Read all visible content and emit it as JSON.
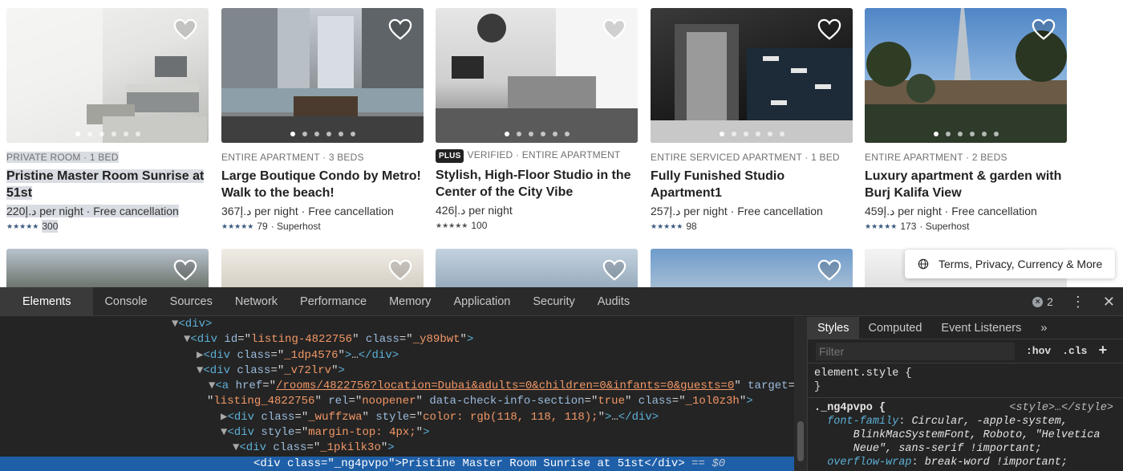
{
  "listings": [
    {
      "kicker": "PRIVATE ROOM · 1 BED",
      "title": "Pristine Master Room Sunrise at 51st",
      "price": "220د.إ per night · Free cancellation",
      "rating_count": "300",
      "rating_extra": "",
      "plus": "",
      "highlight": true,
      "colors": [
        "#e8e8e6",
        "#bcbcb8"
      ]
    },
    {
      "kicker": "ENTIRE APARTMENT · 3 BEDS",
      "title": "Large Boutique Condo by Metro! Walk to the beach!",
      "price": "367د.إ per night · Free cancellation",
      "rating_count": "79",
      "rating_extra": " · Superhost",
      "plus": "",
      "highlight": false,
      "colors": [
        "#9aa0a4",
        "#4f5356"
      ]
    },
    {
      "kicker": "VERIFIED · ENTIRE APARTMENT",
      "title": "Stylish, High-Floor Studio in the Center of the City Vibe",
      "price": "426د.إ per night",
      "rating_count": "100",
      "rating_extra": "",
      "plus": "PLUS",
      "highlight": false,
      "colors": [
        "#d8d8d8",
        "#767676"
      ]
    },
    {
      "kicker": "ENTIRE SERVICED APARTMENT · 1 BED",
      "title": "Fully Funished Studio Apartment1",
      "price": "257د.إ per night · Free cancellation",
      "rating_count": "98",
      "rating_extra": "",
      "plus": "",
      "highlight": false,
      "colors": [
        "#2b2b2b",
        "#0f0f0f"
      ]
    },
    {
      "kicker": "ENTIRE APARTMENT · 2 BEDS",
      "title": "Luxury apartment & garden with Burj Kalifa View",
      "price": "459د.إ per night · Free cancellation",
      "rating_count": "173",
      "rating_extra": " · Superhost",
      "plus": "",
      "highlight": false,
      "colors": [
        "#5b8ec9",
        "#3a3a3a"
      ]
    }
  ],
  "row2_colors": [
    "#8b8f84",
    "#ddd9d2",
    "#a9b8c6",
    "#7aa2c8",
    "#eeeeee"
  ],
  "stars": "★★★★★",
  "footer": {
    "label": "Terms, Privacy, Currency & More"
  },
  "devtools": {
    "tabs": [
      "Elements",
      "Console",
      "Sources",
      "Network",
      "Performance",
      "Memory",
      "Application",
      "Security",
      "Audits"
    ],
    "error_count": "2",
    "styles_tabs": [
      "Styles",
      "Computed",
      "Event Listeners"
    ],
    "filter_placeholder": "Filter",
    "hov": ":hov",
    "cls": ".cls",
    "element_style": "element.style {",
    "element_style_close": "}",
    "rule_selector": "._ng4pvpo {",
    "rule_source": "<style>…</style>",
    "font_family_name": "font-family",
    "font_family_value": "Circular, -apple-system,",
    "font_family_value2": "BlinkMacSystemFont, Roboto, \"Helvetica",
    "font_family_value3": "Neue\", sans-serif !important;",
    "overflow_name": "overflow-wrap",
    "overflow_value": "break-word !important;",
    "dom": {
      "l1": "<div>",
      "l2_id": "listing-4822756",
      "l2_class": "_y89bwt",
      "l3_class": "_1dp4576",
      "l4_class": "_v72lrv",
      "l5_href": "/rooms/4822756?location=Dubai&adults=0&children=0&infants=0&guests=0",
      "l6_target": "listing_4822756",
      "l6_rel": "noopener",
      "l6_check": "true",
      "l6_class": "_1ol0z3h",
      "l7_class": "_wuffzwa",
      "l7_style": "color: rgb(118, 118, 118);",
      "l8_style": "margin-top: 4px;",
      "l9_class": "_1pkilk3o",
      "l10_class": "_ng4pvpo",
      "l10_text": "Pristine Master Room Sunrise at 51st",
      "l10_eq": "== $0"
    }
  }
}
